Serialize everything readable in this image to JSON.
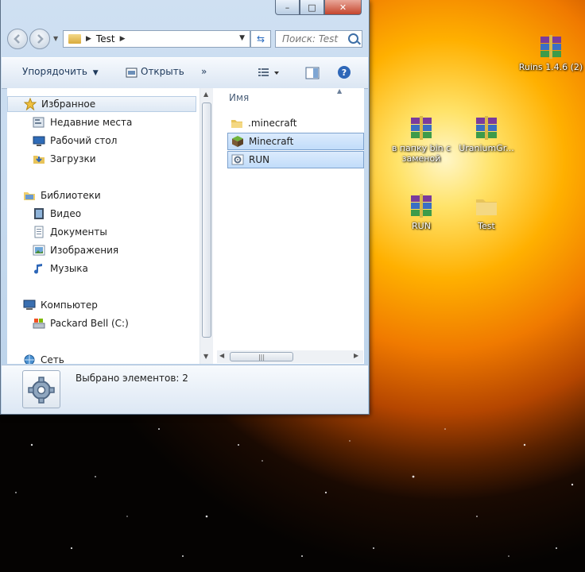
{
  "window": {
    "caption_buttons": {
      "minimize": "–",
      "maximize": "□",
      "close": "✕"
    },
    "address": {
      "crumb": "Test",
      "separator": "▶"
    },
    "search": {
      "placeholder": "Поиск: Test"
    },
    "toolbar": {
      "organize": "Упорядочить",
      "open": "Открыть",
      "more": "»"
    },
    "nav": {
      "favorites": {
        "label": "Избранное",
        "icon": "star-icon"
      },
      "favorites_items": [
        {
          "label": "Недавние места",
          "icon": "recent-places-icon"
        },
        {
          "label": "Рабочий стол",
          "icon": "desktop-icon"
        },
        {
          "label": "Загрузки",
          "icon": "downloads-icon"
        }
      ],
      "libraries": {
        "label": "Библиотеки",
        "icon": "libraries-icon"
      },
      "libraries_items": [
        {
          "label": "Видео",
          "icon": "video-icon"
        },
        {
          "label": "Документы",
          "icon": "documents-icon"
        },
        {
          "label": "Изображения",
          "icon": "pictures-icon"
        },
        {
          "label": "Музыка",
          "icon": "music-icon"
        }
      ],
      "computer": {
        "label": "Компьютер",
        "icon": "computer-icon"
      },
      "computer_items": [
        {
          "label": "Packard Bell (C:)",
          "icon": "drive-icon"
        }
      ],
      "network": {
        "label": "Сеть",
        "icon": "network-icon"
      }
    },
    "files": {
      "column_name": "Имя",
      "items": [
        {
          "name": ".minecraft",
          "icon": "folder-icon",
          "selected": false
        },
        {
          "name": "Minecraft",
          "icon": "minecraft-icon",
          "selected": true
        },
        {
          "name": "RUN",
          "icon": "batch-file-icon",
          "selected": true
        }
      ]
    },
    "status": {
      "selected_text": "Выбрано элементов: 2"
    }
  },
  "desktop": {
    "icons": [
      {
        "label": "Ruins 1.4.6 (2)",
        "icon": "winrar-archive-icon"
      },
      {
        "label": "в папку bin с заменой",
        "icon": "winrar-archive-icon"
      },
      {
        "label": "UraniumGr...",
        "icon": "winrar-archive-icon"
      },
      {
        "label": "RUN",
        "icon": "winrar-archive-icon"
      },
      {
        "label": "Test",
        "icon": "folder-icon"
      }
    ]
  },
  "colors": {
    "selection": "#c1dcfa",
    "window_frame": "#bcd3ea",
    "toolbar_text": "#1e395b"
  }
}
